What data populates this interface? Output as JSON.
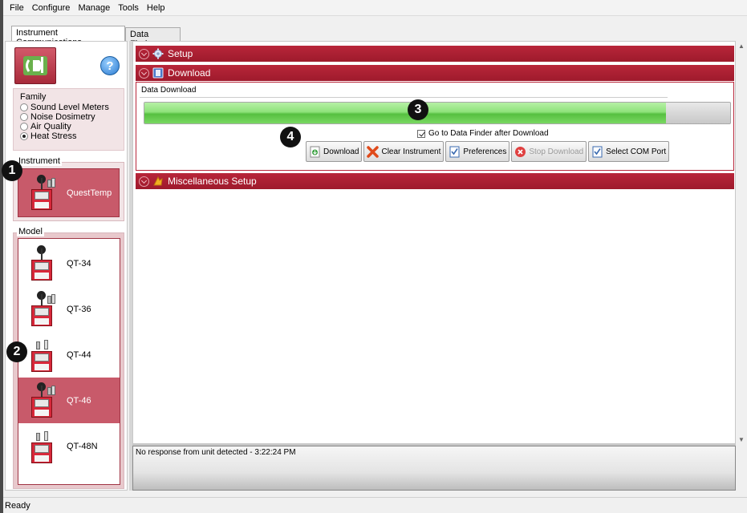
{
  "menu": [
    "File",
    "Configure",
    "Manage",
    "Tools",
    "Help"
  ],
  "tabs": [
    "Instrument Communications",
    "Data Finder"
  ],
  "sidebar": {
    "help_symbol": "?",
    "family_title": "Family",
    "family_options": [
      {
        "label": "Sound Level Meters",
        "selected": false
      },
      {
        "label": "Noise Dosimetry",
        "selected": false
      },
      {
        "label": "Air Quality",
        "selected": false
      },
      {
        "label": "Heat Stress",
        "selected": true
      }
    ],
    "instrument_legend": "Instrument",
    "instrument_name": "QuestTemp",
    "model_legend": "Model",
    "models": [
      {
        "label": "QT-34",
        "selected": false
      },
      {
        "label": "QT-36",
        "selected": false
      },
      {
        "label": "QT-44",
        "selected": false
      },
      {
        "label": "QT-46",
        "selected": true
      },
      {
        "label": "QT-48N",
        "selected": false
      }
    ]
  },
  "sections": {
    "setup": "Setup",
    "download": "Download",
    "misc": "Miscellaneous Setup"
  },
  "download": {
    "panel_label": "Data Download",
    "progress": 0.89,
    "goto_label": "Go to Data Finder after Download",
    "goto_checked": true,
    "buttons": {
      "download": "Download",
      "clear": "Clear Instrument",
      "preferences": "Preferences",
      "stop": "Stop Download",
      "com_port": "Select COM Port"
    }
  },
  "log_text": "No response from unit detected - 3:22:24 PM",
  "status": "Ready",
  "callouts": [
    "1",
    "2",
    "3",
    "4"
  ],
  "colors": {
    "accent": "#a81f33",
    "selected": "#c85a6a",
    "progress": "#6cd056"
  }
}
